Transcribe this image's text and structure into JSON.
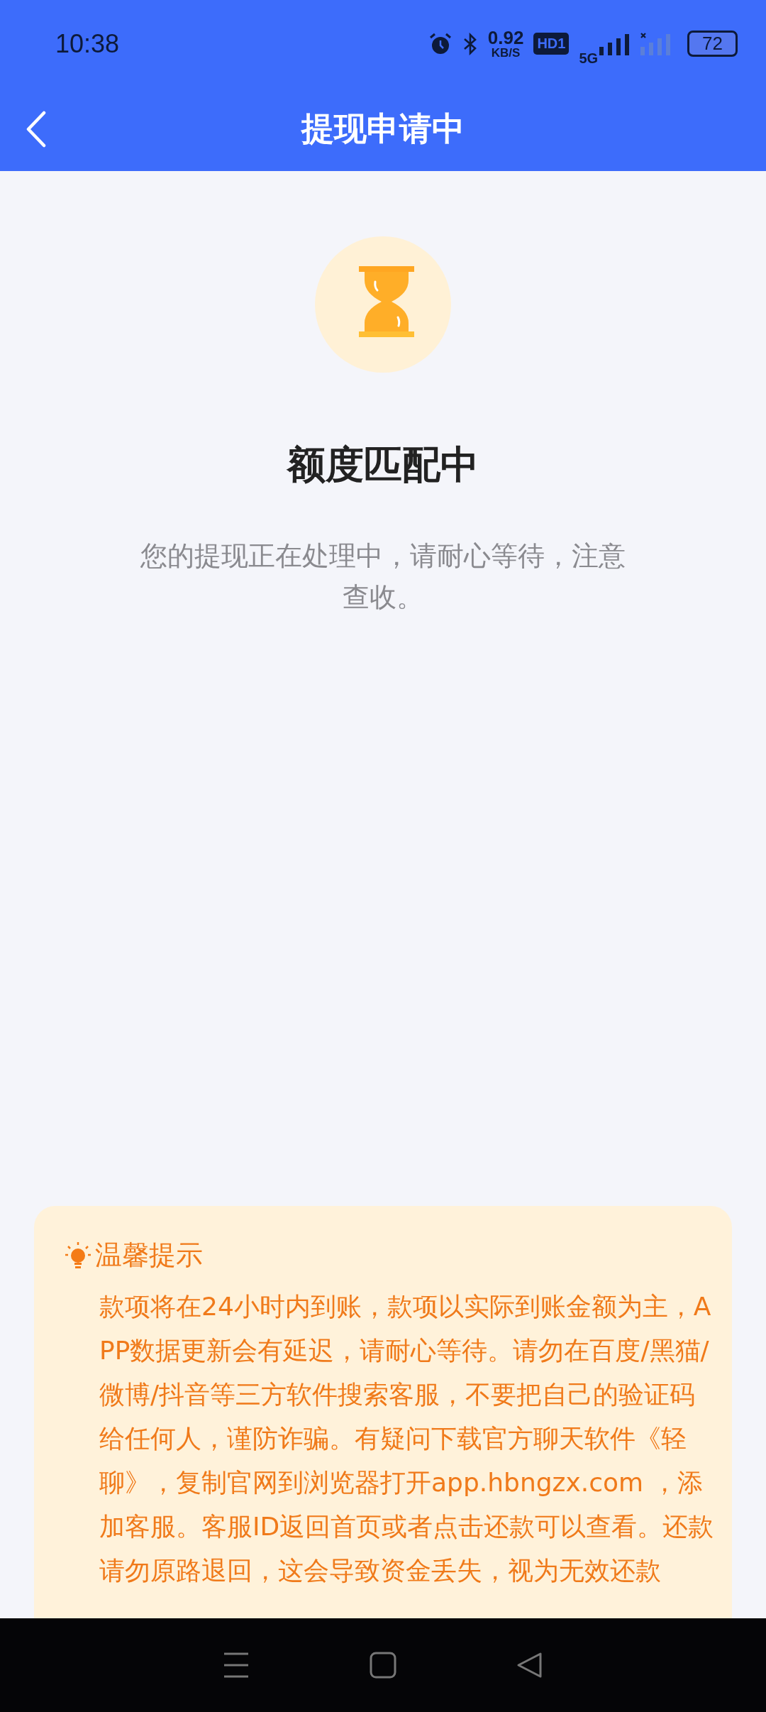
{
  "status_bar": {
    "time": "10:38",
    "speed_value": "0.92",
    "speed_unit": "KB/S",
    "hd_badge": "HD1",
    "network": "5G",
    "battery": "72"
  },
  "header": {
    "title": "提现申请中"
  },
  "status": {
    "title": "额度匹配中",
    "message": "您的提现正在处理中，请耐心等待，注意查收。"
  },
  "tip": {
    "title": "温馨提示",
    "body": "款项将在24小时内到账，款项以实际到账金额为主，APP数据更新会有延迟，请耐心等待。请勿在百度/黑猫/微博/抖音等三方软件搜索客服，不要把自己的验证码给任何人，谨防诈骗。有疑问下载官方聊天软件《轻聊》，复制官网到浏览器打开app.hbngzx.com ，添加客服。客服ID返回首页或者点击还款可以查看。还款请勿原路退回，这会导致资金丢失，视为无效还款"
  }
}
